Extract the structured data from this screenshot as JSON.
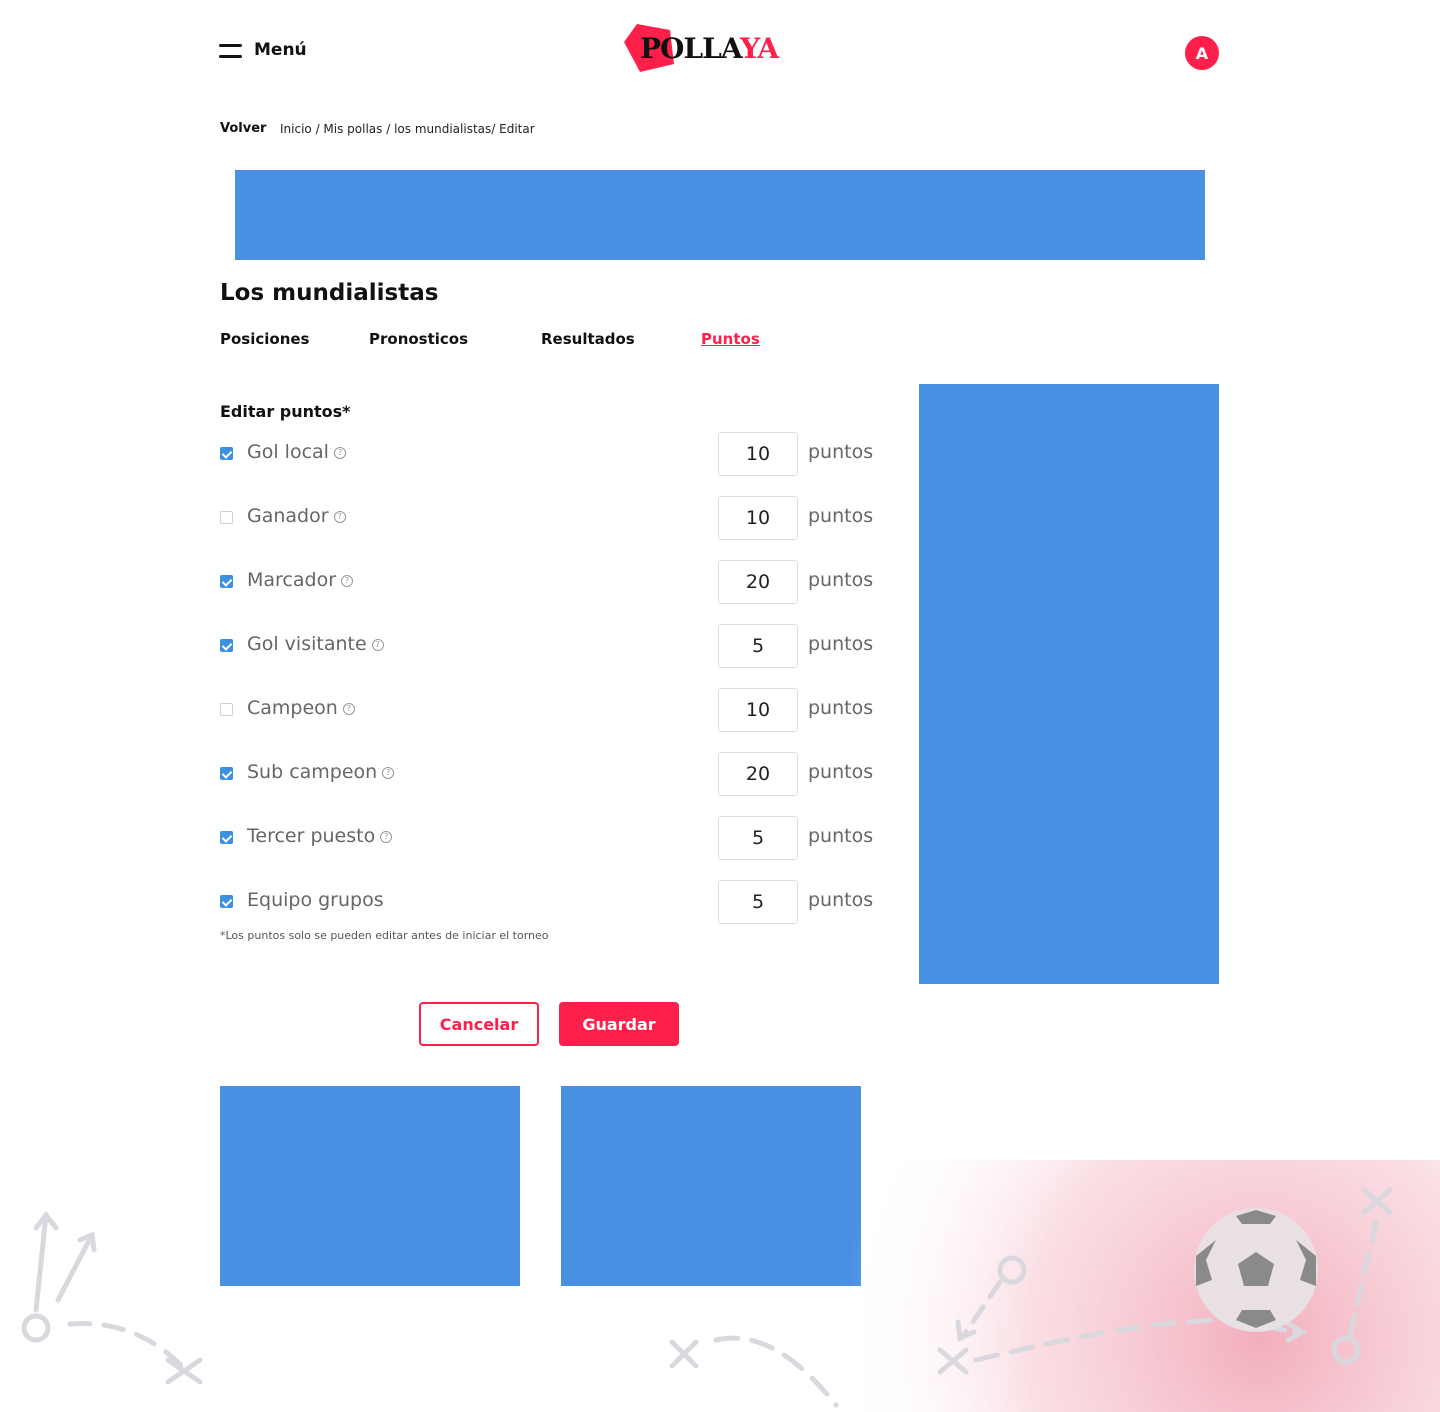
{
  "header": {
    "menu_label": "Menú",
    "logo": {
      "part1": "POLLA",
      "part2": "YA"
    },
    "avatar_initial": "A"
  },
  "breadcrumb": {
    "back_label": "Volver",
    "path": "Inicio / Mis pollas / los mundialistas/ Editar"
  },
  "page": {
    "title": "Los mundialistas"
  },
  "tabs": [
    {
      "label": "Posiciones",
      "active": false
    },
    {
      "label": "Pronosticos",
      "active": false
    },
    {
      "label": "Resultados",
      "active": false
    },
    {
      "label": "Puntos",
      "active": true
    }
  ],
  "form": {
    "subtitle": "Editar puntos*",
    "unit_label": "puntos",
    "help_glyph": "?",
    "rows": [
      {
        "label": "Gol local",
        "checked": true,
        "value": "10",
        "help": true
      },
      {
        "label": "Ganador",
        "checked": false,
        "value": "10",
        "help": true
      },
      {
        "label": "Marcador",
        "checked": true,
        "value": "20",
        "help": true
      },
      {
        "label": "Gol visitante",
        "checked": true,
        "value": "5",
        "help": true
      },
      {
        "label": "Campeon",
        "checked": false,
        "value": "10",
        "help": true
      },
      {
        "label": "Sub campeon",
        "checked": true,
        "value": "20",
        "help": true
      },
      {
        "label": "Tercer puesto",
        "checked": true,
        "value": "5",
        "help": true
      },
      {
        "label": "Equipo grupos",
        "checked": true,
        "value": "5",
        "help": false
      }
    ],
    "note": "*Los puntos solo se pueden editar antes de iniciar el torneo",
    "cancel_label": "Cancelar",
    "save_label": "Guardar"
  },
  "colors": {
    "accent": "#ff1f4b",
    "ad_placeholder": "#4a90e2",
    "checkbox": "#3d8fe0"
  }
}
